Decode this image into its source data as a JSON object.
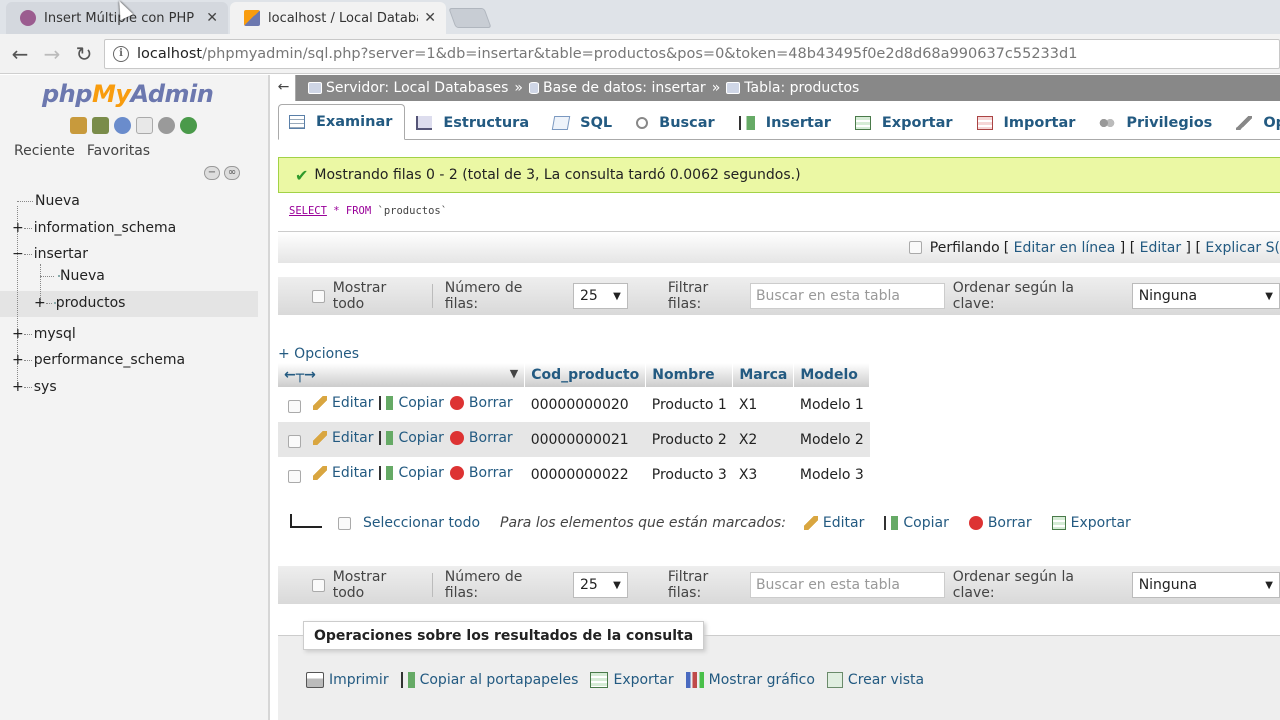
{
  "browser": {
    "tabs": [
      {
        "label": "Insert Múltiple con PHP",
        "active": false,
        "favicon": "woo-icon"
      },
      {
        "label": "localhost / Local Databas",
        "active": true,
        "favicon": "phpmyadmin-icon"
      }
    ],
    "url_host": "localhost",
    "url_path": "/phpmyadmin/sql.php?server=1&db=insertar&table=productos&pos=0&token=48b43495f0e2d8d68a990637c55233d1"
  },
  "sidebar": {
    "logo_php": "php",
    "logo_my": "My",
    "logo_admin": "Admin",
    "tab_recent": "Reciente",
    "tab_favorites": "Favoritas",
    "tree": [
      {
        "label": "Nueva",
        "type": "new"
      },
      {
        "label": "information_schema",
        "type": "db"
      },
      {
        "label": "insertar",
        "type": "db",
        "expanded": true
      },
      {
        "label": "Nueva",
        "type": "new-child"
      },
      {
        "label": "productos",
        "type": "table",
        "selected": true
      },
      {
        "label": "mysql",
        "type": "db"
      },
      {
        "label": "performance_schema",
        "type": "db"
      },
      {
        "label": "sys",
        "type": "db"
      }
    ]
  },
  "breadcrumb": {
    "server": "Servidor: Local Databases",
    "database": "Base de datos: insertar",
    "table": "Tabla: productos",
    "sep": "»"
  },
  "tabs": [
    "Examinar",
    "Estructura",
    "SQL",
    "Buscar",
    "Insertar",
    "Exportar",
    "Importar",
    "Privilegios",
    "Operacio"
  ],
  "message": "Mostrando filas 0 - 2 (total de 3, La consulta tardó 0.0062 segundos.)",
  "sql": {
    "select": "SELECT",
    "rest": " * FROM ",
    "table": "`productos`"
  },
  "profile": {
    "label": "Perfilando",
    "edit_inline": "Editar en línea",
    "edit": "Editar",
    "explain": "Explicar S("
  },
  "navbar": {
    "show_all": "Mostrar todo",
    "rows_label": "Número de filas:",
    "rows_value": "25",
    "filter_label": "Filtrar filas:",
    "filter_placeholder": "Buscar en esta tabla",
    "sort_label": "Ordenar según la clave:",
    "sort_value": "Ninguna"
  },
  "options_link": "+ Opciones",
  "table": {
    "columns": [
      "Cod_producto",
      "Nombre",
      "Marca",
      "Modelo"
    ],
    "actions": {
      "edit": "Editar",
      "copy": "Copiar",
      "delete": "Borrar"
    },
    "rows": [
      [
        "00000000020",
        "Producto 1",
        "X1",
        "Modelo 1"
      ],
      [
        "00000000021",
        "Producto 2",
        "X2",
        "Modelo 2"
      ],
      [
        "00000000022",
        "Producto 3",
        "X3",
        "Modelo 3"
      ]
    ]
  },
  "bulk": {
    "select_all": "Seleccionar todo",
    "marked_label": "Para los elementos que están marcados:",
    "edit": "Editar",
    "copy": "Copiar",
    "delete": "Borrar",
    "export": "Exportar"
  },
  "operations": {
    "legend": "Operaciones sobre los resultados de la consulta",
    "print": "Imprimir",
    "copy_clipboard": "Copiar al portapapeles",
    "export": "Exportar",
    "chart": "Mostrar gráfico",
    "create_view": "Crear vista"
  },
  "colors": {
    "link": "#235a81",
    "success_bg": "#ebf8a4",
    "breadcrumb_bg": "#888888"
  }
}
